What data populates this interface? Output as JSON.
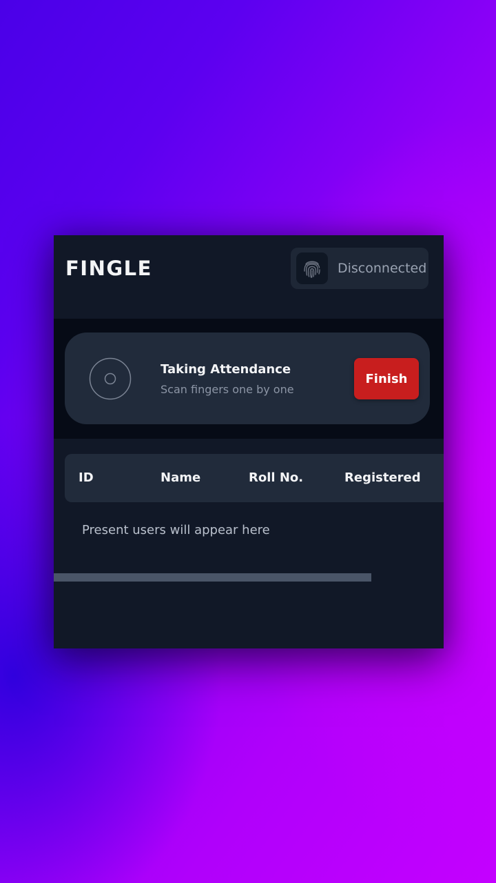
{
  "header": {
    "app_title": "FINGLE",
    "device_status": {
      "icon": "fingerprint-icon",
      "label": "Disconnected"
    }
  },
  "attendance": {
    "icon": "scan-target-icon",
    "title": "Taking Attendance",
    "subtitle": "Scan fingers one by one",
    "finish_label": "Finish"
  },
  "table": {
    "columns": [
      "ID",
      "Name",
      "Roll No.",
      "Registered"
    ],
    "rows": [],
    "empty_message": "Present users will appear here"
  },
  "colors": {
    "window_background": "#111827",
    "card_background": "#212b3b",
    "finish_button": "#c81e1e",
    "text_primary": "#f3f4f6",
    "text_muted": "#8c95a5"
  }
}
